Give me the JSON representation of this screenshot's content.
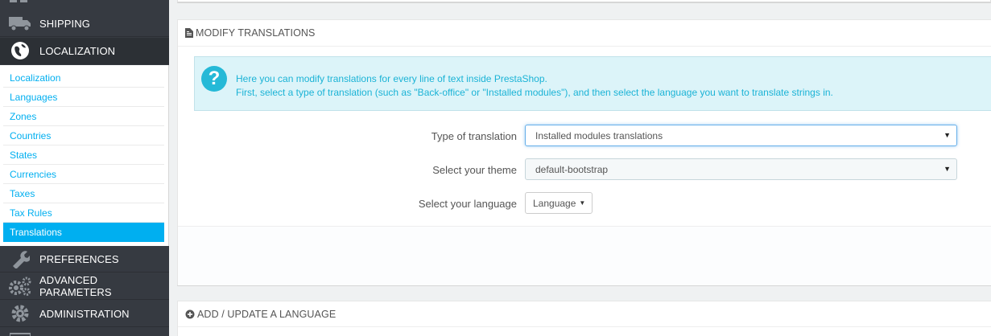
{
  "sidebar": {
    "menu": [
      {
        "label": "SHIPPING",
        "icon": "truck-icon"
      },
      {
        "label": "LOCALIZATION",
        "icon": "globe-icon"
      },
      {
        "label": "PREFERENCES",
        "icon": "wrench-icon"
      },
      {
        "label": "ADVANCED PARAMETERS",
        "icon": "gears-icon"
      },
      {
        "label": "ADMINISTRATION",
        "icon": "gear-icon"
      }
    ],
    "submenu": [
      "Localization",
      "Languages",
      "Zones",
      "Countries",
      "States",
      "Currencies",
      "Taxes",
      "Tax Rules",
      "Translations"
    ],
    "active_submenu": "Translations"
  },
  "modify_panel": {
    "title": "MODIFY TRANSLATIONS",
    "help_line1": "Here you can modify translations for every line of text inside PrestaShop.",
    "help_line2": "First, select a type of translation (such as \"Back-office\" or \"Installed modules\"), and then select the language you want to translate strings in.",
    "type_label": "Type of translation",
    "type_value": "Installed modules translations",
    "theme_label": "Select your theme",
    "theme_value": "default-bootstrap",
    "language_label": "Select your language",
    "language_button": "Language"
  },
  "add_panel": {
    "title": "ADD / UPDATE A LANGUAGE"
  },
  "colors": {
    "sidebar_bg": "#363a41",
    "accent": "#00aff0",
    "help_text": "#1bb3d6"
  }
}
